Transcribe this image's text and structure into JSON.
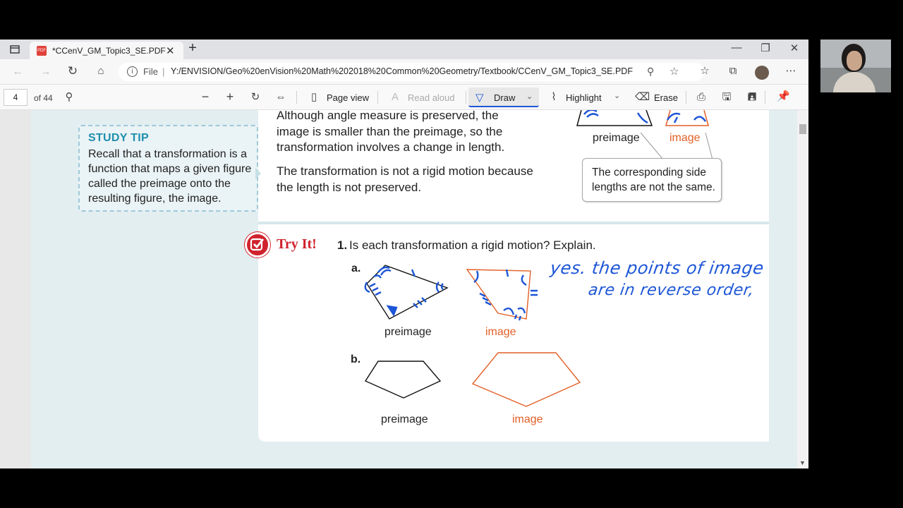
{
  "browser": {
    "tab_title": "*CCenV_GM_Topic3_SE.PDF",
    "pdf_badge": "PDF",
    "new_tab_icon": "+",
    "url_prefix": "File",
    "url": "Y:/ENVISION/Geo%20enVision%20Math%202018%20Common%20Geometry/Textbook/CCenV_GM_Topic3_SE.PDF"
  },
  "pdf_toolbar": {
    "page_number": "4",
    "page_count": "of 44",
    "page_view_label": "Page view",
    "read_aloud_label": "Read aloud",
    "draw_label": "Draw",
    "highlight_label": "Highlight",
    "erase_label": "Erase"
  },
  "document": {
    "intro_lines": [
      "Although angle measure is preserved, the",
      "image is smaller than the preimage, so the",
      "transformation involves a change in length."
    ],
    "conclusion_lines": [
      "The transformation is not a rigid motion because",
      "the length is not preserved."
    ],
    "top_preimage_label": "preimage",
    "top_image_label": "image",
    "callout_lines": [
      "The corresponding side",
      "lengths are not the same."
    ],
    "study_tip": {
      "title": "STUDY TIP",
      "lines": [
        "Recall that a transformation is a",
        "function that maps a given figure",
        "called the preimage onto the",
        "resulting figure, the image."
      ]
    },
    "try_it": {
      "heading": "Try It!",
      "number": "1.",
      "question": "Is each transformation a rigid motion? Explain.",
      "part_a": "a.",
      "part_b": "b.",
      "a_preimage_label": "preimage",
      "a_image_label": "image",
      "b_preimage_label": "preimage",
      "b_image_label": "image"
    },
    "handwritten_answer": [
      "yes. the points of image",
      "are in reverse order,"
    ]
  },
  "colors": {
    "ink_blue": "#1d56d6",
    "image_orange": "#e25f26",
    "tip_teal": "#1f8fae",
    "try_it_red": "#d0222e"
  }
}
